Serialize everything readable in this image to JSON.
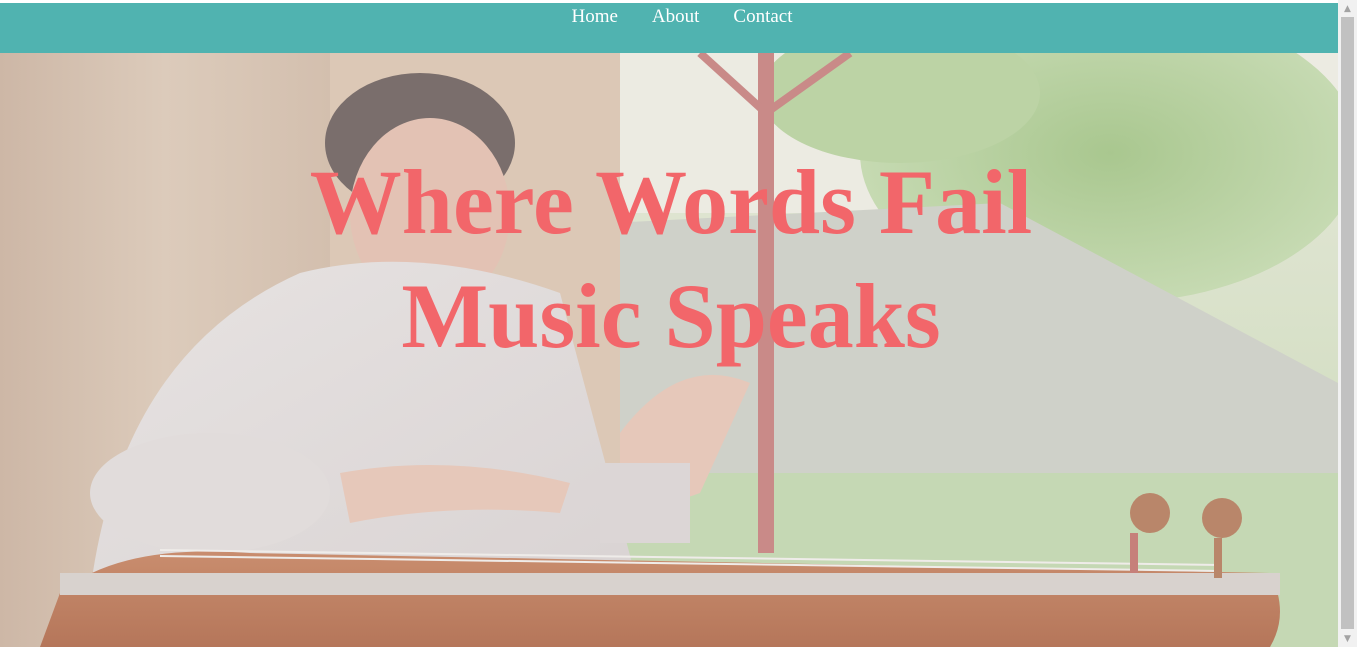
{
  "nav": {
    "items": [
      {
        "label": "Home"
      },
      {
        "label": "About"
      },
      {
        "label": "Contact"
      }
    ]
  },
  "hero": {
    "title_line1": "Where Words Fail",
    "title_line2": "Music Speaks",
    "image_icon": "musician-playing-santoor-photo"
  },
  "colors": {
    "navbar": "#50b3b0",
    "title": "#f2666a",
    "nav_text": "#ffffff"
  },
  "scrollbar": {
    "up_icon": "scroll-up-arrow",
    "down_icon": "scroll-down-arrow"
  }
}
